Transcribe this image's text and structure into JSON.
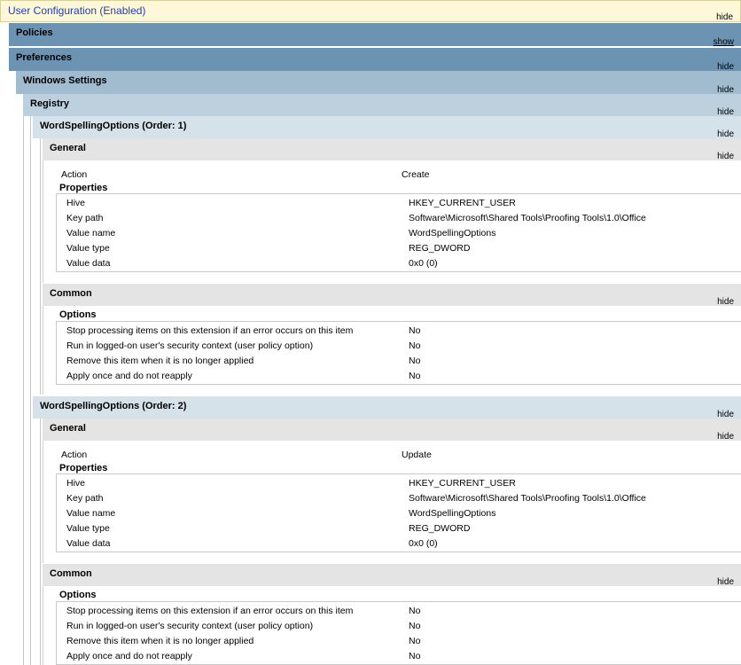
{
  "user_config": {
    "title": "User Configuration (Enabled)",
    "toggle": "hide"
  },
  "policies": {
    "title": "Policies",
    "toggle": "show"
  },
  "preferences": {
    "title": "Preferences",
    "toggle": "hide"
  },
  "windows_settings": {
    "title": "Windows Settings",
    "toggle": "hide"
  },
  "registry": {
    "title": "Registry",
    "toggle": "hide"
  },
  "items": [
    {
      "title": "WordSpellingOptions (Order: 1)",
      "toggle": "hide",
      "general": {
        "title": "General",
        "toggle": "hide",
        "action_label": "Action",
        "action_value": "Create",
        "properties_label": "Properties",
        "properties": [
          {
            "k": "Hive",
            "v": "HKEY_CURRENT_USER"
          },
          {
            "k": "Key path",
            "v": "Software\\Microsoft\\Shared Tools\\Proofing Tools\\1.0\\Office"
          },
          {
            "k": "Value name",
            "v": "WordSpellingOptions"
          },
          {
            "k": "Value type",
            "v": "REG_DWORD"
          },
          {
            "k": "Value data",
            "v": "0x0 (0)"
          }
        ]
      },
      "common": {
        "title": "Common",
        "toggle": "hide",
        "options_label": "Options",
        "options": [
          {
            "k": "Stop processing items on this extension if an error occurs on this item",
            "v": "No"
          },
          {
            "k": "Run in logged-on user's security context (user policy option)",
            "v": "No"
          },
          {
            "k": "Remove this item when it is no longer applied",
            "v": "No"
          },
          {
            "k": "Apply once and do not reapply",
            "v": "No"
          }
        ]
      }
    },
    {
      "title": "WordSpellingOptions (Order: 2)",
      "toggle": "hide",
      "general": {
        "title": "General",
        "toggle": "hide",
        "action_label": "Action",
        "action_value": "Update",
        "properties_label": "Properties",
        "properties": [
          {
            "k": "Hive",
            "v": "HKEY_CURRENT_USER"
          },
          {
            "k": "Key path",
            "v": "Software\\Microsoft\\Shared Tools\\Proofing Tools\\1.0\\Office"
          },
          {
            "k": "Value name",
            "v": "WordSpellingOptions"
          },
          {
            "k": "Value type",
            "v": "REG_DWORD"
          },
          {
            "k": "Value data",
            "v": "0x0 (0)"
          }
        ]
      },
      "common": {
        "title": "Common",
        "toggle": "hide",
        "options_label": "Options",
        "options": [
          {
            "k": "Stop processing items on this extension if an error occurs on this item",
            "v": "No"
          },
          {
            "k": "Run in logged-on user's security context (user policy option)",
            "v": "No"
          },
          {
            "k": "Remove this item when it is no longer applied",
            "v": "No"
          },
          {
            "k": "Apply once and do not reapply",
            "v": "No"
          }
        ]
      }
    }
  ]
}
